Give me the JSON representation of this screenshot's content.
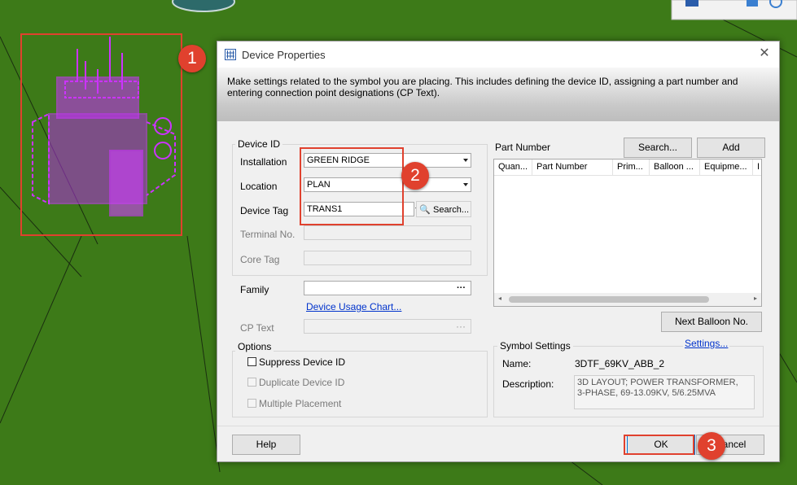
{
  "dialog": {
    "title": "Device Properties",
    "close_icon": "close-icon",
    "description": "Make settings related to the symbol you are placing. This includes defining the device ID, assigning a part number and entering connection point designations (CP Text)."
  },
  "device_id": {
    "group_label": "Device ID",
    "installation": {
      "label": "Installation",
      "value": "GREEN RIDGE"
    },
    "location": {
      "label": "Location",
      "value": "PLAN"
    },
    "device_tag": {
      "label": "Device Tag",
      "value": "TRANS1",
      "search_label": "Search..."
    },
    "terminal_no": {
      "label": "Terminal No."
    },
    "core_tag": {
      "label": "Core Tag"
    }
  },
  "family": {
    "label": "Family",
    "ellipsis": "···",
    "usage_link": "Device Usage Chart..."
  },
  "cp_text": {
    "label": "CP Text",
    "ellipsis": "···"
  },
  "options": {
    "group_label": "Options",
    "suppress": "Suppress Device ID",
    "duplicate": "Duplicate Device ID",
    "multiple": "Multiple Placement"
  },
  "part_number": {
    "label": "Part Number",
    "search_button": "Search...",
    "add_button": "Add",
    "columns": [
      "Quan...",
      "Part Number",
      "Prim...",
      "Balloon ...",
      "Equipme...",
      "I"
    ],
    "next_balloon_button": "Next Balloon No."
  },
  "symbol_settings": {
    "group_label": "Symbol Settings",
    "settings_link": "Settings...",
    "name_label": "Name:",
    "name_value": "3DTF_69KV_ABB_2",
    "description_label": "Description:",
    "description_value": "3D LAYOUT; POWER TRANSFORMER, 3-PHASE, 69-13.09KV, 5/6.25MVA"
  },
  "footer": {
    "help": "Help",
    "ok": "OK",
    "cancel": "ancel"
  },
  "markers": [
    "1",
    "2",
    "3"
  ],
  "colors": {
    "accent": "#e0412e",
    "background": "#3d7a18",
    "symbol": "#cc33ff",
    "link": "#0033cc"
  }
}
